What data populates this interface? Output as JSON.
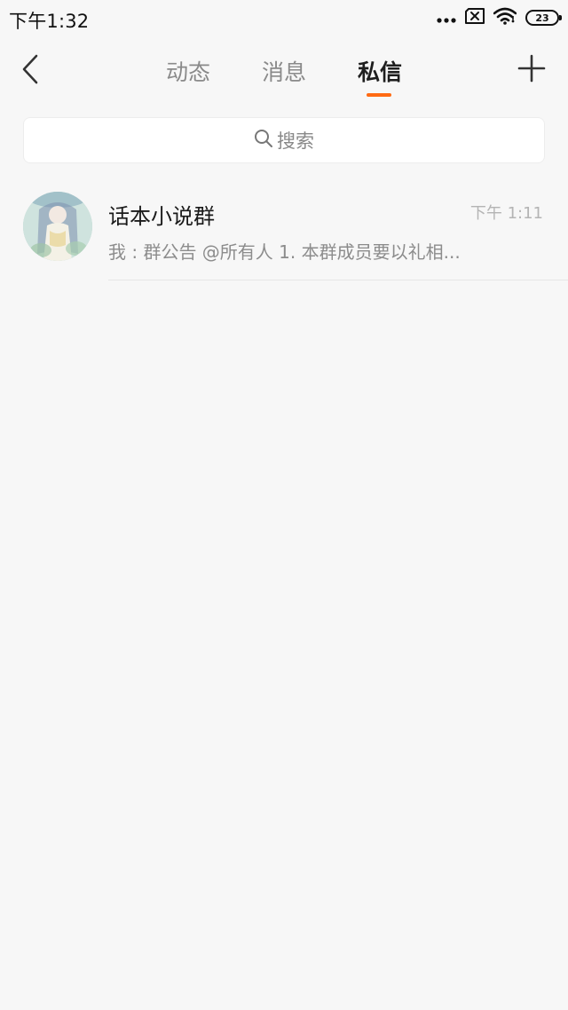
{
  "status_bar": {
    "time": "下午1:32",
    "battery": "23",
    "icons": [
      "more-dots-icon",
      "sim-error-icon",
      "wifi-icon",
      "battery-icon"
    ]
  },
  "nav": {
    "tabs": [
      {
        "label": "动态",
        "active": false
      },
      {
        "label": "消息",
        "active": false
      },
      {
        "label": "私信",
        "active": true
      }
    ],
    "accent_color": "#ff6a13"
  },
  "search": {
    "placeholder": "搜索"
  },
  "conversations": [
    {
      "title": "话本小说群",
      "time": "下午 1:11",
      "preview": "我 : 群公告 @所有人 1. 本群成员要以礼相..."
    }
  ]
}
